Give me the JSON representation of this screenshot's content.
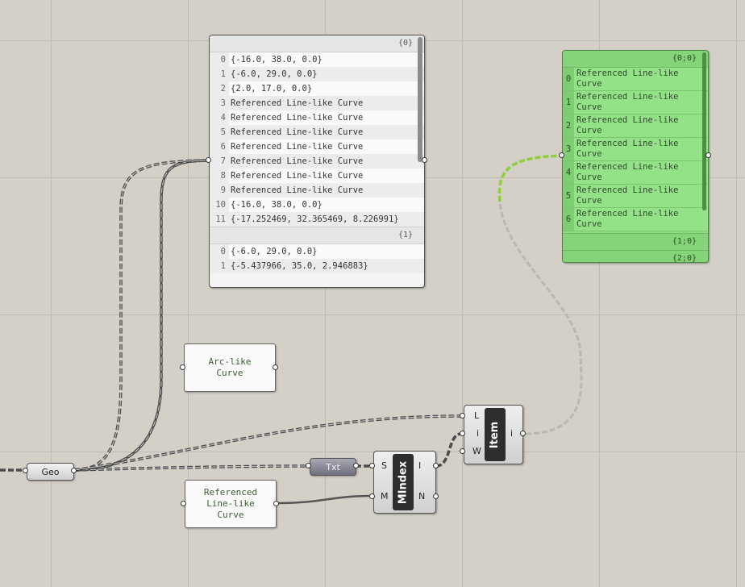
{
  "panel_data": {
    "branch0": "{0}",
    "branch1": "{1}",
    "rows0": [
      {
        "i": "0",
        "v": "{-16.0, 38.0, 0.0}"
      },
      {
        "i": "1",
        "v": "{-6.0, 29.0, 0.0}"
      },
      {
        "i": "2",
        "v": "{2.0, 17.0, 0.0}"
      },
      {
        "i": "3",
        "v": "Referenced Line-like Curve"
      },
      {
        "i": "4",
        "v": "Referenced Line-like Curve"
      },
      {
        "i": "5",
        "v": "Referenced Line-like Curve"
      },
      {
        "i": "6",
        "v": "Referenced Line-like Curve"
      },
      {
        "i": "7",
        "v": "Referenced Line-like Curve"
      },
      {
        "i": "8",
        "v": "Referenced Line-like Curve"
      },
      {
        "i": "9",
        "v": "Referenced Line-like Curve"
      },
      {
        "i": "10",
        "v": "{-16.0, 38.0, 0.0}"
      },
      {
        "i": "11",
        "v": "{-17.252469, 32.365469, 8.226991}"
      }
    ],
    "rows1": [
      {
        "i": "0",
        "v": "{-6.0, 29.0, 0.0}"
      },
      {
        "i": "1",
        "v": "{-5.437966, 35.0, 2.946883}"
      }
    ]
  },
  "panel_green": {
    "branch0": "{0;0}",
    "branch1": "{1;0}",
    "branch2": "{2;0}",
    "rows": [
      {
        "i": "0",
        "v": "Referenced Line-like Curve"
      },
      {
        "i": "1",
        "v": "Referenced Line-like Curve"
      },
      {
        "i": "2",
        "v": "Referenced Line-like Curve"
      },
      {
        "i": "3",
        "v": "Referenced Line-like Curve"
      },
      {
        "i": "4",
        "v": "Referenced Line-like Curve"
      },
      {
        "i": "5",
        "v": "Referenced Line-like Curve"
      },
      {
        "i": "6",
        "v": "Referenced Line-like Curve"
      }
    ]
  },
  "arc_node": {
    "text": "Arc-like\nCurve"
  },
  "line_node": {
    "text": "Referenced\nLine-like\nCurve"
  },
  "geo": {
    "label": "Geo"
  },
  "txt": {
    "label": "Txt"
  },
  "mindex": {
    "nickname": "MIndex",
    "in_s": "S",
    "in_m": "M",
    "out_i": "I",
    "out_n": "N"
  },
  "item": {
    "nickname": "Item",
    "in_l": "L",
    "in_i": "i",
    "in_w": "W",
    "out_i": "i"
  },
  "colors": {
    "canvas": "#d4d0c8",
    "wire": "#4a4a4a",
    "wire_selected": "#8fcf3c",
    "wire_faded": "#b8b8b0",
    "green_panel": "#8fdc82"
  }
}
